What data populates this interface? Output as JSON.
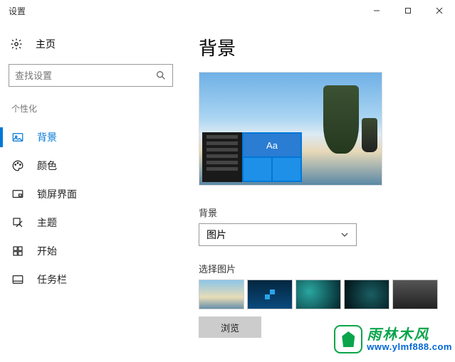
{
  "window": {
    "title": "设置"
  },
  "sidebar": {
    "home": "主页",
    "search_placeholder": "查找设置",
    "section": "个性化",
    "items": [
      {
        "label": "背景"
      },
      {
        "label": "颜色"
      },
      {
        "label": "锁屏界面"
      },
      {
        "label": "主题"
      },
      {
        "label": "开始"
      },
      {
        "label": "任务栏"
      }
    ]
  },
  "main": {
    "title": "背景",
    "preview_tile_text": "Aa",
    "bg_label": "背景",
    "bg_dropdown_value": "图片",
    "choose_label": "选择图片",
    "browse": "浏览"
  },
  "watermark": {
    "cn": "雨林木风",
    "url": "www.ylmf888.com"
  }
}
